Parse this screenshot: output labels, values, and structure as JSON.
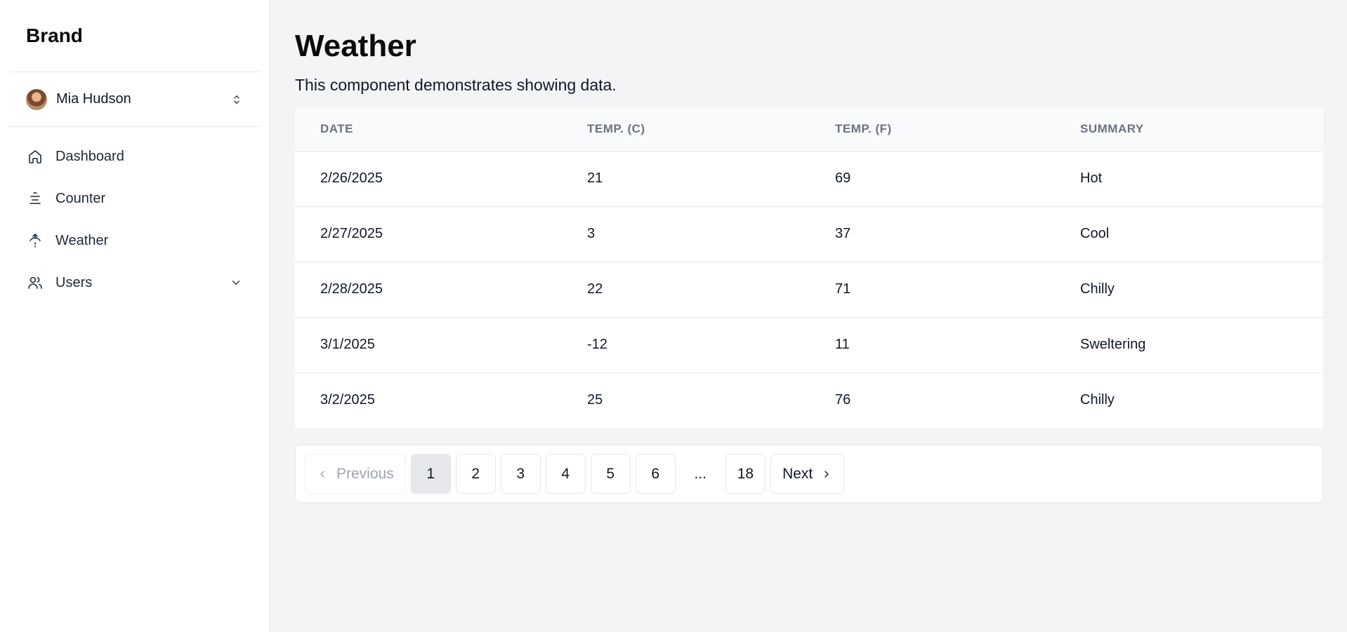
{
  "sidebar": {
    "brand": "Brand",
    "user": {
      "name": "Mia Hudson"
    },
    "items": [
      {
        "label": "Dashboard",
        "icon": "home-icon"
      },
      {
        "label": "Counter",
        "icon": "counter-icon"
      },
      {
        "label": "Weather",
        "icon": "weather-icon"
      },
      {
        "label": "Users",
        "icon": "users-icon"
      }
    ]
  },
  "main": {
    "title": "Weather",
    "description": "This component demonstrates showing data.",
    "table": {
      "columns": [
        "DATE",
        "TEMP. (C)",
        "TEMP. (F)",
        "SUMMARY"
      ],
      "rows": [
        [
          "2/26/2025",
          "21",
          "69",
          "Hot"
        ],
        [
          "2/27/2025",
          "3",
          "37",
          "Cool"
        ],
        [
          "2/28/2025",
          "22",
          "71",
          "Chilly"
        ],
        [
          "3/1/2025",
          "-12",
          "11",
          "Sweltering"
        ],
        [
          "3/2/2025",
          "25",
          "76",
          "Chilly"
        ]
      ]
    },
    "pagination": {
      "previous": "Previous",
      "next": "Next",
      "pages": [
        "1",
        "2",
        "3",
        "4",
        "5",
        "6"
      ],
      "ellipsis": "...",
      "last": "18",
      "current": "1"
    }
  }
}
